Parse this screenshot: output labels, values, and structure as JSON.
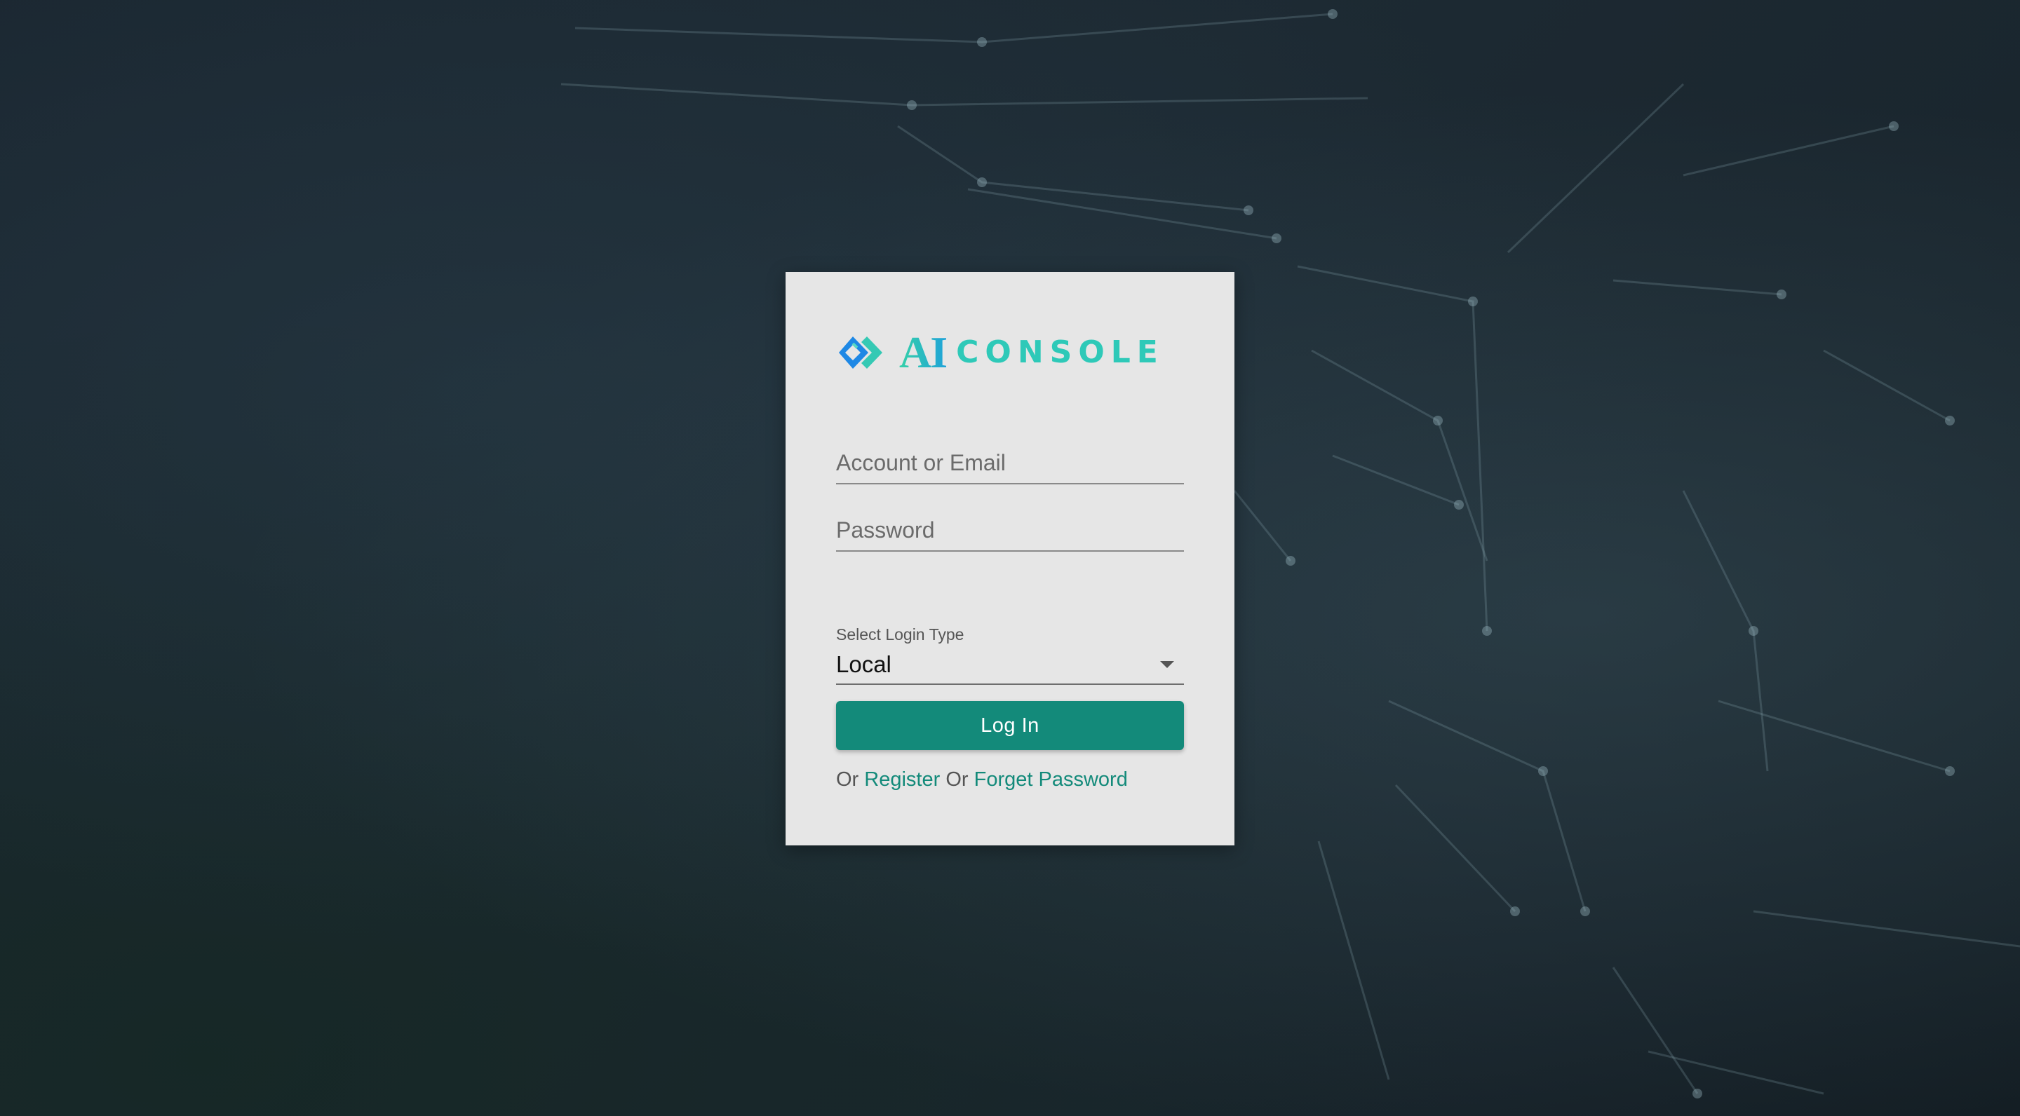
{
  "brand": {
    "logo_ai": "AI",
    "logo_text": "CONSOLE",
    "logo_icon": "diamond-chevron-icon",
    "colors": {
      "logo_blue": "#1e88e5",
      "logo_teal": "#2ec9b8"
    }
  },
  "form": {
    "account_placeholder": "Account or Email",
    "password_placeholder": "Password",
    "login_type_label": "Select Login Type",
    "login_type_value": "Local",
    "login_button": "Log In"
  },
  "footer": {
    "or_1": "Or",
    "register_link": "Register",
    "or_2": "Or",
    "forget_link": "Forget Password"
  },
  "colors": {
    "accent": "#138a7a",
    "card_background": "#e6e6e6",
    "page_background": "#16222b"
  }
}
